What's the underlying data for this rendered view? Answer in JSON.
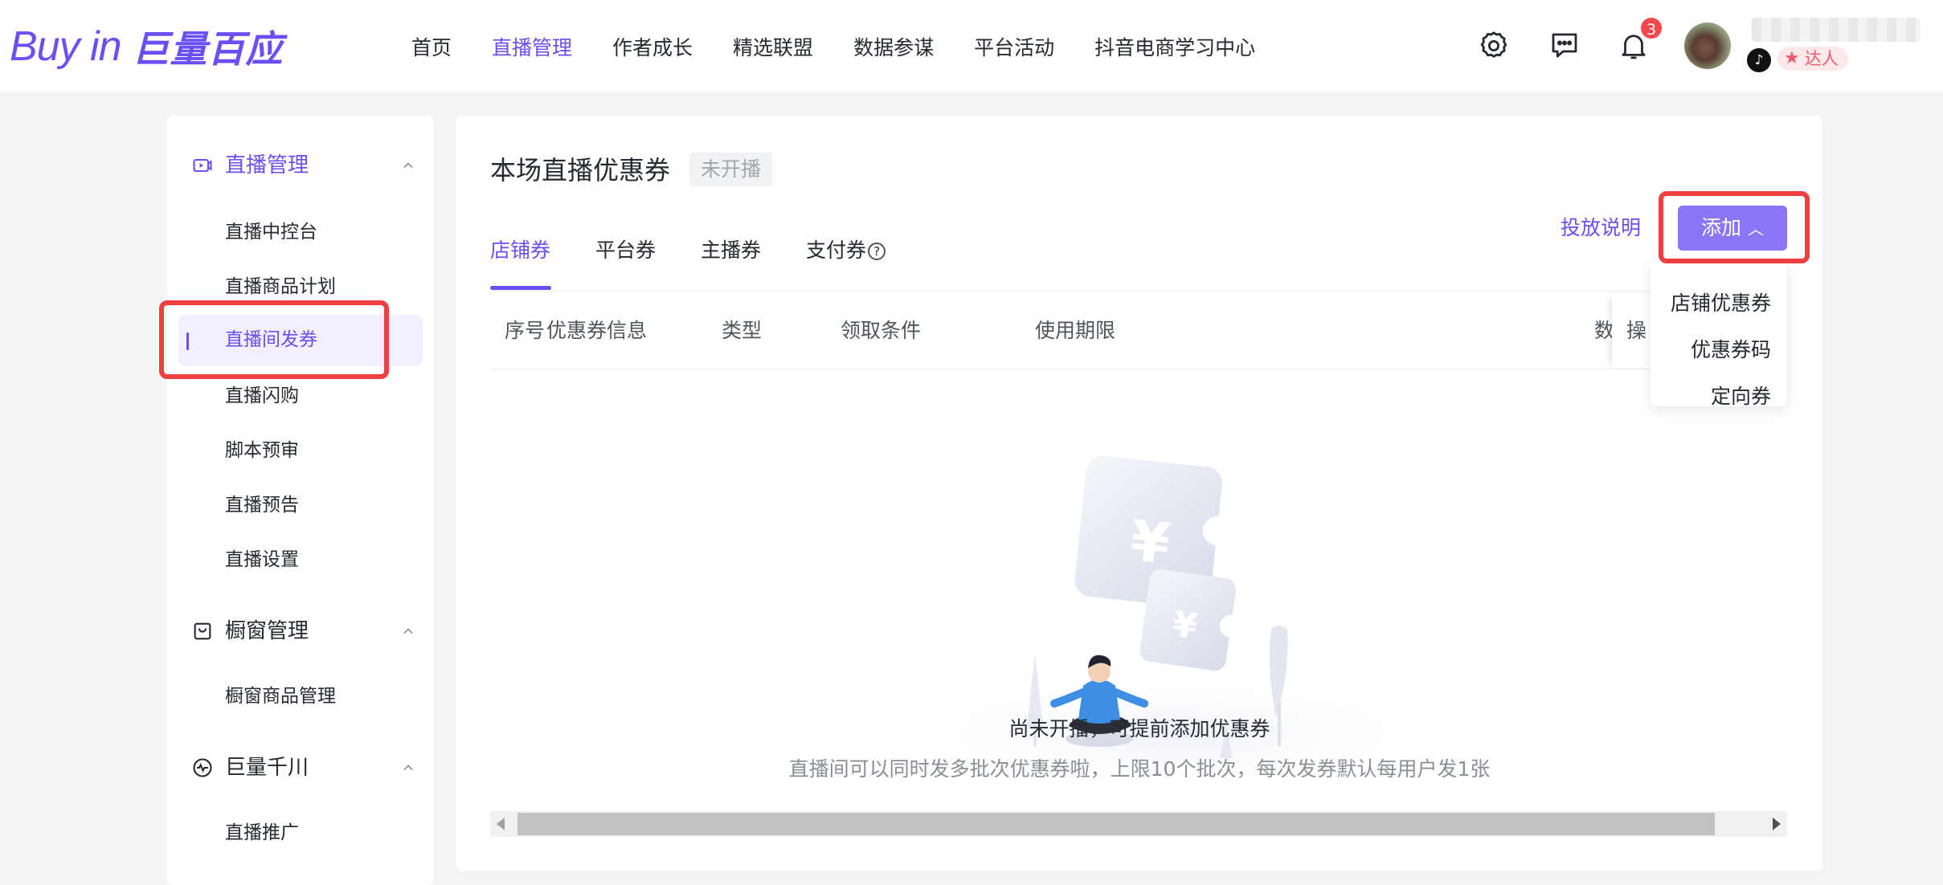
{
  "header": {
    "logo_en": "Buy in",
    "logo_cn": "巨量百应",
    "nav": [
      {
        "label": "首页",
        "active": false
      },
      {
        "label": "直播管理",
        "active": true
      },
      {
        "label": "作者成长",
        "active": false
      },
      {
        "label": "精选联盟",
        "active": false
      },
      {
        "label": "数据参谋",
        "active": false
      },
      {
        "label": "平台活动",
        "active": false
      },
      {
        "label": "抖音电商学习中心",
        "active": false
      }
    ],
    "icons": [
      "settings-icon",
      "message-icon",
      "bell-icon"
    ],
    "notification_count": "3",
    "user_role": "达人"
  },
  "sidebar": {
    "groups": [
      {
        "label": "直播管理",
        "icon": "live-icon",
        "expanded": true,
        "items": [
          "直播中控台",
          "直播商品计划",
          "直播间发券",
          "直播闪购",
          "脚本预审",
          "直播预告",
          "直播设置"
        ],
        "active_item": "直播间发券"
      },
      {
        "label": "橱窗管理",
        "icon": "showcase-icon",
        "expanded": true,
        "items": [
          "橱窗商品管理"
        ]
      },
      {
        "label": "巨量千川",
        "icon": "pulse-icon",
        "expanded": true,
        "items": [
          "直播推广"
        ]
      }
    ]
  },
  "main": {
    "title": "本场直播优惠券",
    "status": "未开播",
    "tabs": [
      {
        "label": "店铺券",
        "active": true
      },
      {
        "label": "平台券",
        "active": false
      },
      {
        "label": "主播券",
        "active": false
      },
      {
        "label": "支付券",
        "active": false,
        "help": "?"
      }
    ],
    "delivery_note_link": "投放说明",
    "add_button": "添加",
    "add_menu": [
      "店铺优惠券",
      "优惠券码",
      "定向券"
    ],
    "table_headers": [
      "序号",
      "优惠券信息",
      "类型",
      "领取条件",
      "使用期限",
      "数",
      "操"
    ],
    "empty_title": "尚未开播，可提前添加优惠券",
    "empty_desc": "直播间可以同时发多批次优惠券啦，上限10个批次，每次发券默认每用户发1张",
    "illustration_symbol": "¥"
  },
  "colors": {
    "accent": "#6b4ef6",
    "button": "#8c74f6",
    "highlight": "#ee4040",
    "badge": "#f5484d"
  }
}
